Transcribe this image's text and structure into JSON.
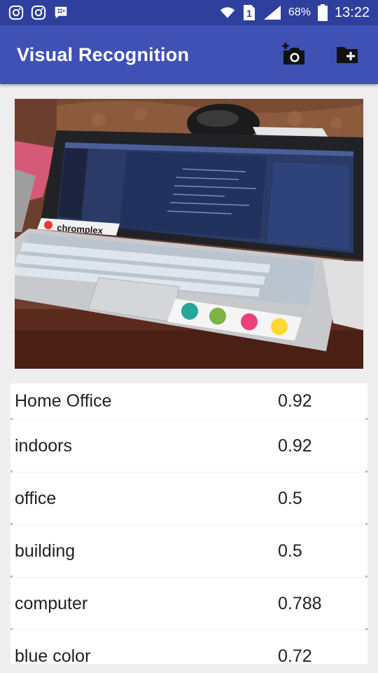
{
  "status": {
    "battery": "68%",
    "time": "13:22",
    "sim": "1"
  },
  "app": {
    "title": "Visual Recognition",
    "actions": [
      "camera-icon",
      "add-folder-icon"
    ]
  },
  "results": [
    {
      "label": "Home Office",
      "score": "0.92"
    },
    {
      "label": "indoors",
      "score": "0.92"
    },
    {
      "label": "office",
      "score": "0.5"
    },
    {
      "label": "building",
      "score": "0.5"
    },
    {
      "label": "computer",
      "score": "0.788"
    },
    {
      "label": "blue color",
      "score": "0.72"
    }
  ],
  "colors": {
    "status_bar": "#2e3f9e",
    "app_bar": "#3f51b5",
    "background": "#eeeeee"
  }
}
